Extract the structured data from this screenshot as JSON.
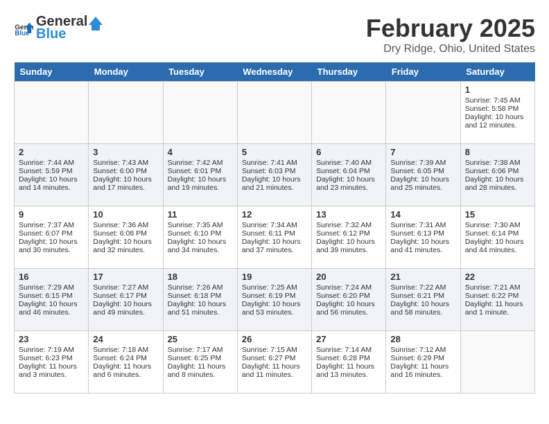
{
  "header": {
    "logo_general": "General",
    "logo_blue": "Blue",
    "title": "February 2025",
    "subtitle": "Dry Ridge, Ohio, United States"
  },
  "days_of_week": [
    "Sunday",
    "Monday",
    "Tuesday",
    "Wednesday",
    "Thursday",
    "Friday",
    "Saturday"
  ],
  "weeks": [
    [
      {
        "num": "",
        "content": ""
      },
      {
        "num": "",
        "content": ""
      },
      {
        "num": "",
        "content": ""
      },
      {
        "num": "",
        "content": ""
      },
      {
        "num": "",
        "content": ""
      },
      {
        "num": "",
        "content": ""
      },
      {
        "num": "1",
        "content": "Sunrise: 7:45 AM\nSunset: 5:58 PM\nDaylight: 10 hours and 12 minutes."
      }
    ],
    [
      {
        "num": "2",
        "content": "Sunrise: 7:44 AM\nSunset: 5:59 PM\nDaylight: 10 hours and 14 minutes."
      },
      {
        "num": "3",
        "content": "Sunrise: 7:43 AM\nSunset: 6:00 PM\nDaylight: 10 hours and 17 minutes."
      },
      {
        "num": "4",
        "content": "Sunrise: 7:42 AM\nSunset: 6:01 PM\nDaylight: 10 hours and 19 minutes."
      },
      {
        "num": "5",
        "content": "Sunrise: 7:41 AM\nSunset: 6:03 PM\nDaylight: 10 hours and 21 minutes."
      },
      {
        "num": "6",
        "content": "Sunrise: 7:40 AM\nSunset: 6:04 PM\nDaylight: 10 hours and 23 minutes."
      },
      {
        "num": "7",
        "content": "Sunrise: 7:39 AM\nSunset: 6:05 PM\nDaylight: 10 hours and 25 minutes."
      },
      {
        "num": "8",
        "content": "Sunrise: 7:38 AM\nSunset: 6:06 PM\nDaylight: 10 hours and 28 minutes."
      }
    ],
    [
      {
        "num": "9",
        "content": "Sunrise: 7:37 AM\nSunset: 6:07 PM\nDaylight: 10 hours and 30 minutes."
      },
      {
        "num": "10",
        "content": "Sunrise: 7:36 AM\nSunset: 6:08 PM\nDaylight: 10 hours and 32 minutes."
      },
      {
        "num": "11",
        "content": "Sunrise: 7:35 AM\nSunset: 6:10 PM\nDaylight: 10 hours and 34 minutes."
      },
      {
        "num": "12",
        "content": "Sunrise: 7:34 AM\nSunset: 6:11 PM\nDaylight: 10 hours and 37 minutes."
      },
      {
        "num": "13",
        "content": "Sunrise: 7:32 AM\nSunset: 6:12 PM\nDaylight: 10 hours and 39 minutes."
      },
      {
        "num": "14",
        "content": "Sunrise: 7:31 AM\nSunset: 6:13 PM\nDaylight: 10 hours and 41 minutes."
      },
      {
        "num": "15",
        "content": "Sunrise: 7:30 AM\nSunset: 6:14 PM\nDaylight: 10 hours and 44 minutes."
      }
    ],
    [
      {
        "num": "16",
        "content": "Sunrise: 7:29 AM\nSunset: 6:15 PM\nDaylight: 10 hours and 46 minutes."
      },
      {
        "num": "17",
        "content": "Sunrise: 7:27 AM\nSunset: 6:17 PM\nDaylight: 10 hours and 49 minutes."
      },
      {
        "num": "18",
        "content": "Sunrise: 7:26 AM\nSunset: 6:18 PM\nDaylight: 10 hours and 51 minutes."
      },
      {
        "num": "19",
        "content": "Sunrise: 7:25 AM\nSunset: 6:19 PM\nDaylight: 10 hours and 53 minutes."
      },
      {
        "num": "20",
        "content": "Sunrise: 7:24 AM\nSunset: 6:20 PM\nDaylight: 10 hours and 56 minutes."
      },
      {
        "num": "21",
        "content": "Sunrise: 7:22 AM\nSunset: 6:21 PM\nDaylight: 10 hours and 58 minutes."
      },
      {
        "num": "22",
        "content": "Sunrise: 7:21 AM\nSunset: 6:22 PM\nDaylight: 11 hours and 1 minute."
      }
    ],
    [
      {
        "num": "23",
        "content": "Sunrise: 7:19 AM\nSunset: 6:23 PM\nDaylight: 11 hours and 3 minutes."
      },
      {
        "num": "24",
        "content": "Sunrise: 7:18 AM\nSunset: 6:24 PM\nDaylight: 11 hours and 6 minutes."
      },
      {
        "num": "25",
        "content": "Sunrise: 7:17 AM\nSunset: 6:25 PM\nDaylight: 11 hours and 8 minutes."
      },
      {
        "num": "26",
        "content": "Sunrise: 7:15 AM\nSunset: 6:27 PM\nDaylight: 11 hours and 11 minutes."
      },
      {
        "num": "27",
        "content": "Sunrise: 7:14 AM\nSunset: 6:28 PM\nDaylight: 11 hours and 13 minutes."
      },
      {
        "num": "28",
        "content": "Sunrise: 7:12 AM\nSunset: 6:29 PM\nDaylight: 11 hours and 16 minutes."
      },
      {
        "num": "",
        "content": ""
      }
    ]
  ]
}
